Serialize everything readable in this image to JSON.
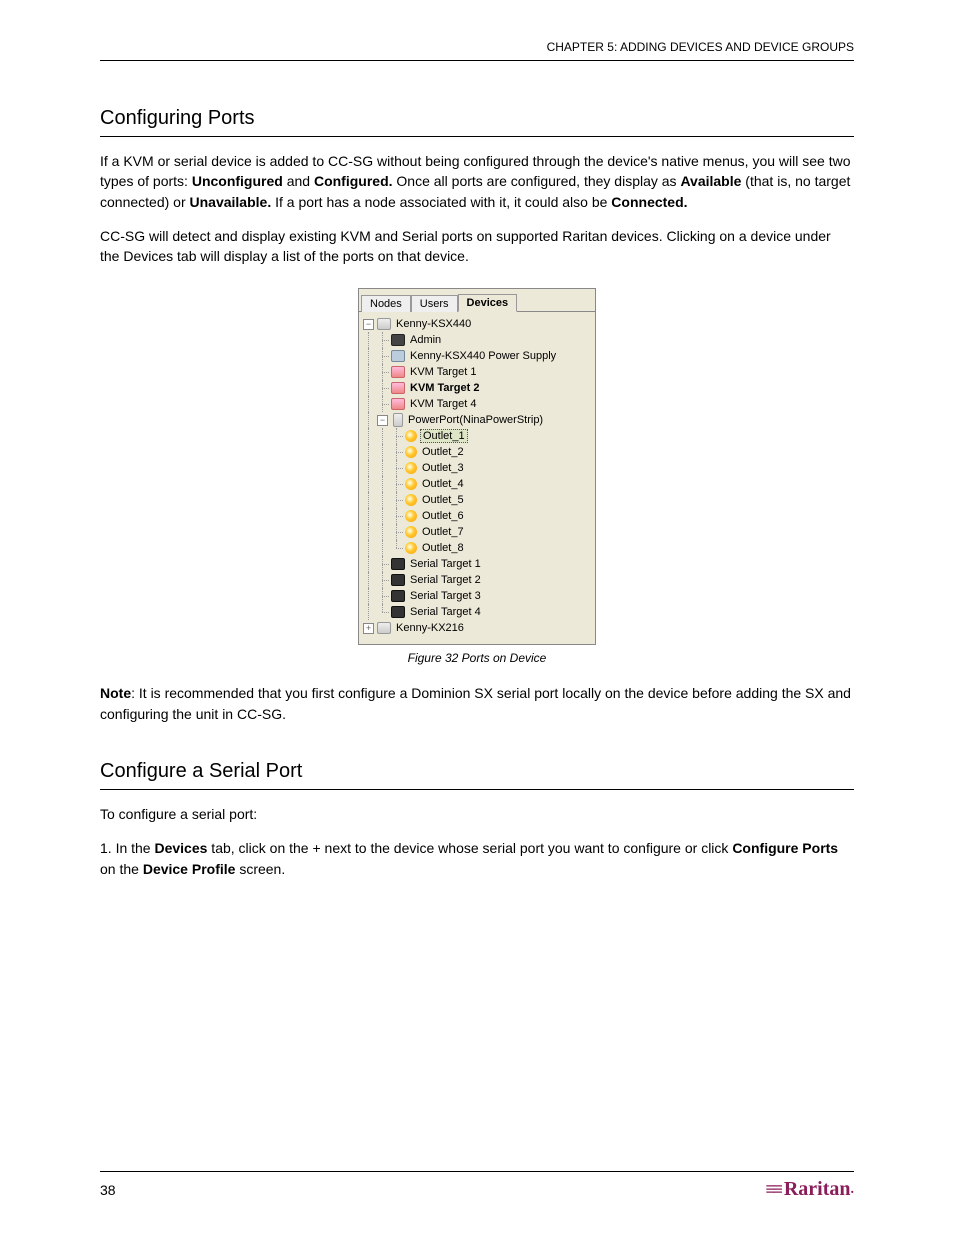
{
  "header": {
    "chapter_line": "CHAPTER 5: ADDING DEVICES AND DEVICE GROUPS"
  },
  "section": {
    "title": "Configuring Ports",
    "p1_pre": "If a KVM or serial device is added to CC-SG without being configured through the device's native menus, you will see two types of ports: ",
    "p1_b1": "Unconfigured",
    "p1_mid1": " and ",
    "p1_b2": "Configured.",
    "p1_mid2": " Once all ports are configured, they display as ",
    "p1_b3": "Available",
    "p1_mid3": " (that is, no target connected) or ",
    "p1_b4": "Unavailable.",
    "p1_mid4": " If a port has a node associated with it, it could also be ",
    "p1_b5": "Connected.",
    "p2": "CC-SG will detect and display existing KVM and Serial ports on supported Raritan devices. Clicking on a device under the Devices tab will display a list of the ports on that device.",
    "p3_pre": "",
    "p3_b1": "Note",
    "p3_mid": ": It is recommended that you first configure a Dominion SX serial port locally on the device before adding the SX and configuring the unit in CC-SG."
  },
  "screenshot": {
    "tabs": {
      "nodes": "Nodes",
      "users": "Users",
      "devices": "Devices"
    },
    "tree": {
      "dev1": "Kenny-KSX440",
      "admin": "Admin",
      "psupply": "Kenny-KSX440  Power Supply",
      "kvm1": "KVM Target 1",
      "kvm2": "KVM Target 2",
      "kvm4": "KVM Target 4",
      "powerport": "PowerPort(NinaPowerStrip)",
      "out1": "Outlet_1",
      "out2": "Outlet_2",
      "out3": "Outlet_3",
      "out4": "Outlet_4",
      "out5": "Outlet_5",
      "out6": "Outlet_6",
      "out7": "Outlet_7",
      "out8": "Outlet_8",
      "ser1": "Serial Target 1",
      "ser2": "Serial Target 2",
      "ser3": "Serial Target 3",
      "ser4": "Serial Target 4",
      "dev2": "Kenny-KX216"
    },
    "toggle_minus": "−",
    "toggle_plus": "+"
  },
  "caption": "Figure 32 Ports on  Device",
  "section2": {
    "title": "Configure a Serial Port",
    "intro": "To configure a serial port:",
    "s1_pre": "1. In the ",
    "s1_b1": "Devices",
    "s1_mid1": " tab, click on the + next to the device whose serial port you want to configure or click ",
    "s1_b2": "Configure Ports",
    "s1_mid2": " on the ",
    "s1_b3": "Device Profile",
    "s1_mid3": " screen."
  },
  "footer": {
    "page": "38",
    "logo_text": "Raritan",
    "logo_dot": "."
  }
}
